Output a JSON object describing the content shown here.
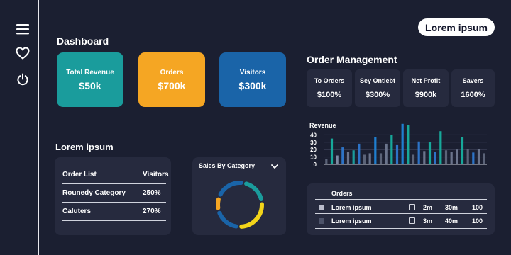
{
  "header": {
    "badge": "Lorem ipsum"
  },
  "dashboard": {
    "title": "Dashboard",
    "cards": [
      {
        "label": "Total Revenue",
        "value": "$50k",
        "color": "#1a9c9c"
      },
      {
        "label": "Orders",
        "value": "$700k",
        "color": "#f5a623"
      },
      {
        "label": "Visitors",
        "value": "$300k",
        "color": "#1a64a8"
      }
    ]
  },
  "order_management": {
    "title": "Order Management",
    "stats": [
      {
        "label": "To Orders",
        "value": "$100%"
      },
      {
        "label": "Sey Ontiebt",
        "value": "$300%"
      },
      {
        "label": "Net Profit",
        "value": "$900k"
      },
      {
        "label": "Savers",
        "value": "1600%"
      }
    ]
  },
  "section2": {
    "title": "Lorem ipsum",
    "table": {
      "headers": [
        "Order List",
        "Visitors"
      ],
      "rows": [
        [
          "Rounedy Category",
          "250%"
        ],
        [
          "Caluters",
          "270%"
        ]
      ]
    }
  },
  "sales": {
    "title": "Sales By Category",
    "segments": [
      {
        "value": 20,
        "color": "#1a9c9c"
      },
      {
        "value": 28,
        "color": "#f2d41a"
      },
      {
        "value": 20,
        "color": "#1a64a8"
      },
      {
        "value": 10,
        "color": "#f5a623"
      },
      {
        "value": 22,
        "color": "#1a64a8"
      }
    ]
  },
  "chart_data": {
    "type": "bar",
    "title": "Revenue",
    "ylim": [
      0,
      50
    ],
    "yticks": [
      0,
      10,
      20,
      30,
      40
    ],
    "grid": true,
    "values": [
      7,
      35,
      12,
      23,
      17,
      19,
      28,
      13,
      15,
      37,
      15,
      28,
      40,
      27,
      55,
      53,
      13,
      31,
      18,
      30,
      17,
      45,
      19,
      17,
      20,
      37,
      21,
      16,
      21,
      15
    ],
    "colors": [
      "#5b6378",
      "#17a89a",
      "#7d8aa3",
      "#2d73c7",
      "#6b748c",
      "#1a9c9c",
      "#2d73c7",
      "#5b6378",
      "#6b748c",
      "#1f7fd0",
      "#5b6378",
      "#6b748c",
      "#17a89a",
      "#2d73c7",
      "#1f7fd0",
      "#17a89a",
      "#5b6378",
      "#2d73c7",
      "#6b748c",
      "#17a89a",
      "#2d73c7",
      "#17a89a",
      "#5b6378",
      "#6b748c",
      "#6b748c",
      "#17a89a",
      "#5b6378",
      "#2d73c7",
      "#6b748c",
      "#5b6378"
    ]
  },
  "orders": {
    "title": "Orders",
    "rows": [
      {
        "name": "Lorem ipsum",
        "a": "2m",
        "b": "30m",
        "c": "100",
        "swatch": "#b9bccb"
      },
      {
        "name": "Lorem ipsum",
        "a": "3m",
        "b": "40m",
        "c": "100",
        "swatch": "#4c5268"
      }
    ]
  },
  "icons": {
    "menu": "menu-icon",
    "heart": "heart-icon",
    "power": "power-icon",
    "chevron": "chevron-down-icon"
  }
}
